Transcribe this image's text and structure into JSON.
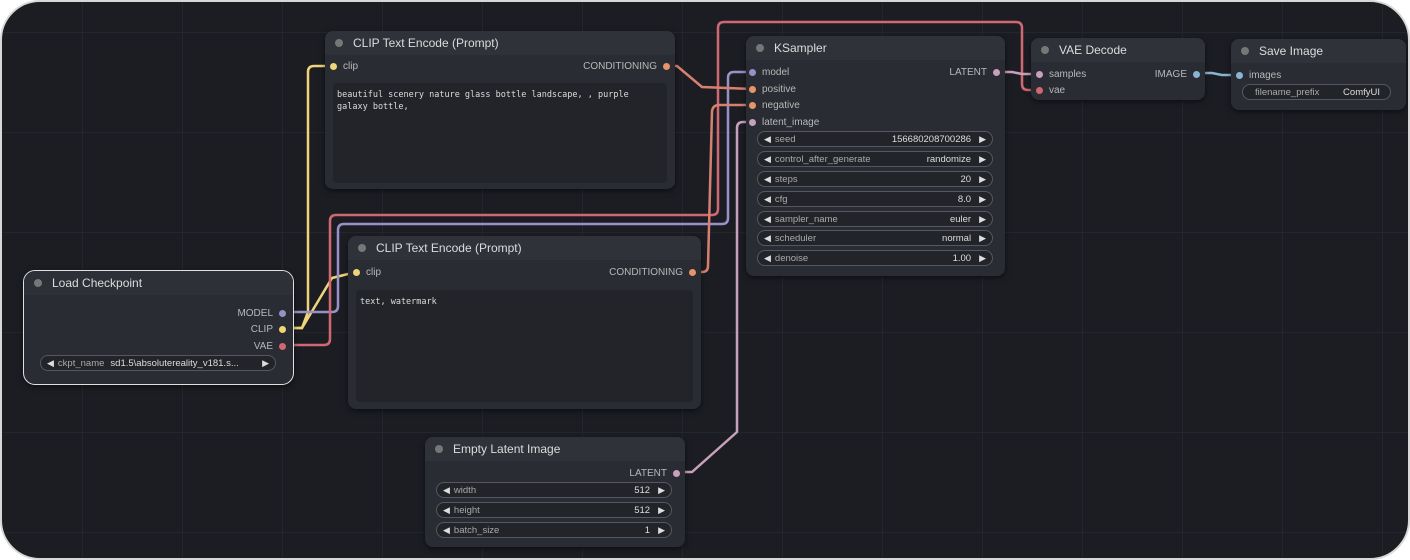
{
  "colors": {
    "clip": "#f0d47a",
    "conditioning": "#d88070",
    "model": "#9a90c8",
    "vae": "#d06872",
    "latent": "#c8a0bc",
    "image": "#8ab4d4"
  },
  "clip_top": {
    "title": "CLIP Text Encode (Prompt)",
    "input": "clip",
    "output": "CONDITIONING",
    "text": "beautiful scenery nature glass bottle landscape, , purple galaxy bottle,"
  },
  "clip_bottom": {
    "title": "CLIP Text Encode (Prompt)",
    "input": "clip",
    "output": "CONDITIONING",
    "text": "text, watermark"
  },
  "checkpoint": {
    "title": "Load Checkpoint",
    "outputs": [
      "MODEL",
      "CLIP",
      "VAE"
    ],
    "widget": {
      "label": "ckpt_name",
      "value": "sd1.5\\absolutereality_v181.s..."
    }
  },
  "ksampler": {
    "title": "KSampler",
    "inputs": [
      "model",
      "positive",
      "negative",
      "latent_image"
    ],
    "output": "LATENT",
    "widgets": [
      {
        "label": "seed",
        "value": "156680208700286"
      },
      {
        "label": "control_after_generate",
        "value": "randomize"
      },
      {
        "label": "steps",
        "value": "20"
      },
      {
        "label": "cfg",
        "value": "8.0"
      },
      {
        "label": "sampler_name",
        "value": "euler"
      },
      {
        "label": "scheduler",
        "value": "normal"
      },
      {
        "label": "denoise",
        "value": "1.00"
      }
    ]
  },
  "empty_latent": {
    "title": "Empty Latent Image",
    "output": "LATENT",
    "widgets": [
      {
        "label": "width",
        "value": "512"
      },
      {
        "label": "height",
        "value": "512"
      },
      {
        "label": "batch_size",
        "value": "1"
      }
    ]
  },
  "vae_decode": {
    "title": "VAE Decode",
    "inputs": [
      "samples",
      "vae"
    ],
    "output": "IMAGE"
  },
  "save_image": {
    "title": "Save Image",
    "input": "images",
    "widget": {
      "label": "filename_prefix",
      "value": "ComfyUI"
    }
  },
  "icons": {
    "arrow_left": "◀",
    "arrow_right": "▶"
  }
}
